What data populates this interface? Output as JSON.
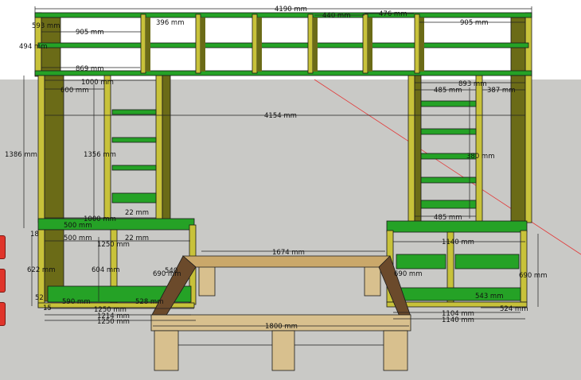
{
  "colors": {
    "sky": "#ffffff",
    "ground": "#c9c9c6",
    "board_edge": "#c8c23a",
    "board_face": "#6b6b17",
    "shelf": "#25a226",
    "shelf_dark": "#1b7a1c",
    "wood": "#d8c08e",
    "wood_top": "#caa86a",
    "wood_dark": "#6b4a2b",
    "axis": "#e23a3a",
    "tab": "#e0342a"
  },
  "dimensions": {
    "top_total": "4190 mm",
    "top_left_width": "905 mm",
    "top_right_width": "905 mm",
    "top_440": "440 mm",
    "top_476": "476 mm",
    "top_396": "396 mm",
    "left_593": "593 mm",
    "left_494": "494 mm",
    "left_869": "869 mm",
    "left_1000_top": "1000 mm",
    "left_600_top": "600 mm",
    "center_4154": "4154 mm",
    "left_1386": "1386 mm",
    "left_1356": "1356 mm",
    "left_1000_bottom": "1000 mm",
    "left_500_a": "500 mm",
    "left_500_b": "500 mm",
    "left_1250_mid": "1250 mm",
    "left_18": "18",
    "left_22_a": "22 mm",
    "left_22_b": "22 mm",
    "left_622": "622 mm",
    "left_604": "604 mm",
    "left_690": "690 mm",
    "left_540": "540",
    "left_52": "52",
    "left_1250_a": "1250 mm",
    "left_1214": "1214 mm",
    "left_1250_b": "1250 mm",
    "left_590": "590 mm",
    "left_528": "528 mm",
    "left_15": "15",
    "right_893": "893 mm",
    "right_485_top": "485 mm",
    "right_387": "387 mm",
    "right_380": "380 mm",
    "right_485_bottom": "485 mm",
    "right_1140_top": "1140 mm",
    "right_690_a": "690 mm",
    "right_690_b": "690 mm",
    "right_543": "543 mm",
    "right_1104": "1104 mm",
    "right_1140_bottom": "1140 mm",
    "right_524": "524 mm",
    "bed_top": "1674 mm",
    "bed_front": "1800 mm"
  }
}
